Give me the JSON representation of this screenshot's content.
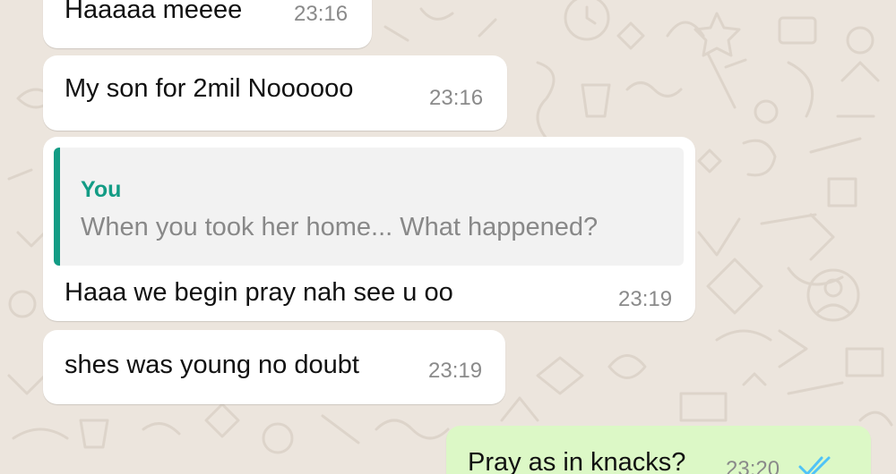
{
  "theme": {
    "wallpaper_color": "#ECE5DD",
    "incoming_bubble_color": "#FFFFFF",
    "outgoing_bubble_color": "#DCF8C6",
    "quote_accent_color": "#139C85",
    "read_ticks_color": "#4FC3F7"
  },
  "messages": [
    {
      "direction": "incoming",
      "text": "Haaaaa meeee",
      "time": "23:16"
    },
    {
      "direction": "incoming",
      "text": "My son for 2mil Noooooo",
      "time": "23:16"
    },
    {
      "direction": "incoming",
      "quoted": {
        "author": "You",
        "text": "When you took her home... What happened?"
      },
      "text": "Haaa we begin pray nah see u oo",
      "time": "23:19"
    },
    {
      "direction": "incoming",
      "text": "shes was young no doubt",
      "time": "23:19"
    },
    {
      "direction": "outgoing",
      "text": "Pray as in knacks?",
      "time": "23:20",
      "status_icon": "double-check-read-icon"
    }
  ]
}
